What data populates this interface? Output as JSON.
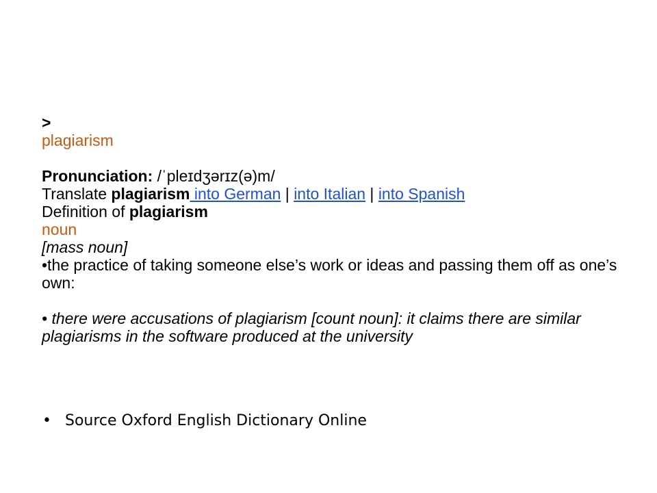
{
  "breadcrumb": ">",
  "headword": "plagiarism",
  "pronunciation": {
    "label": "Pronunciation:",
    "ipa": " /ˈpleɪdʒərɪz(ə)m/"
  },
  "translate": {
    "prefix": "Translate ",
    "word": "plagiarism",
    "links": [
      " into German",
      " into Italian",
      " into Spanish"
    ],
    "separator": " | "
  },
  "definition_heading": {
    "prefix": "Definition of ",
    "word": "plagiarism"
  },
  "part_of_speech": "noun",
  "grammar_note": "[mass noun]",
  "sense": "•the practice of taking someone else’s work or ideas and passing them off as one’s own:",
  "example": "• there were accusations of plagiarism [count noun]: it claims there are similar plagiarisms in the software produced at the university",
  "source": {
    "bullet": "•",
    "text": "Source Oxford English Dictionary Online"
  },
  "colors": {
    "headword": "#c55a11",
    "link": "#1f4fe0"
  }
}
